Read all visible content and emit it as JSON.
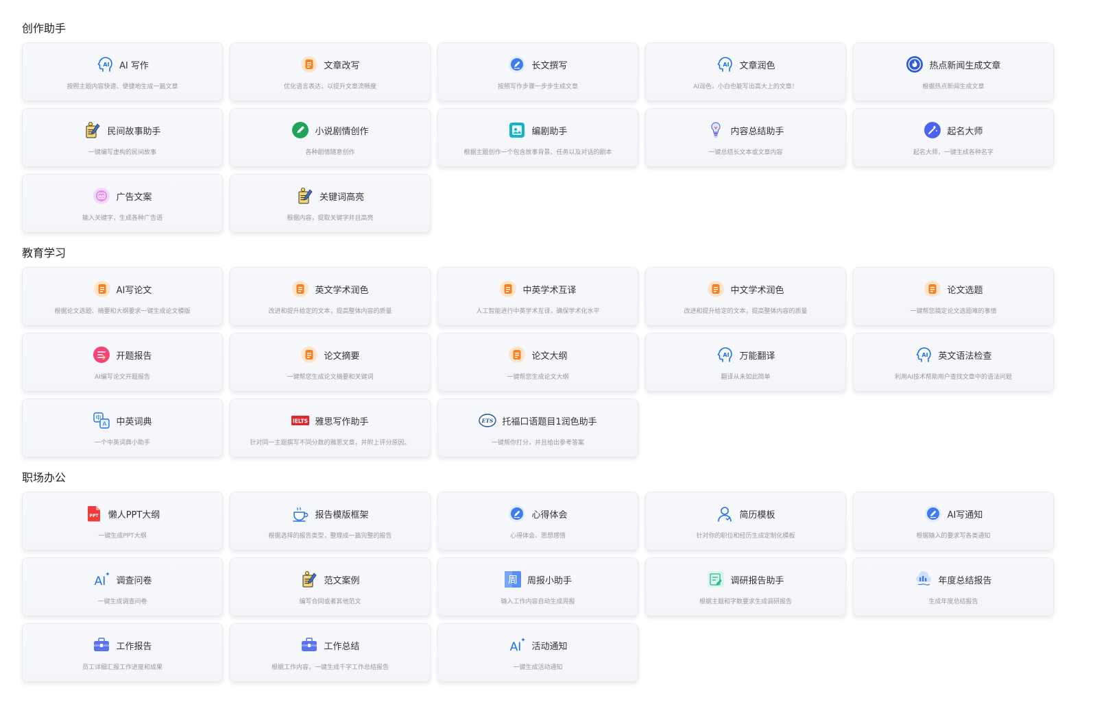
{
  "sections": [
    {
      "title": "创作助手",
      "cards": [
        {
          "title": "AI 写作",
          "desc": "按照主题内容快速、便捷地生成一篇文章",
          "icon": "ai-head-icon"
        },
        {
          "title": "文章改写",
          "desc": "优化语言表达，以提升文章流畅度",
          "icon": "doc-orange-icon"
        },
        {
          "title": "长文撰写",
          "desc": "按照写作步骤一步步生成文章",
          "icon": "pen-blue-icon"
        },
        {
          "title": "文章润色",
          "desc": "AI润色，小白也能写出高大上的文章！",
          "icon": "ai-head-icon"
        },
        {
          "title": "热点新闻生成文章",
          "desc": "根据热点新闻生成文章",
          "icon": "hot-news-icon"
        },
        {
          "title": "民间故事助手",
          "desc": "一键编写虚构的民间故事",
          "icon": "notepad-bulb-icon"
        },
        {
          "title": "小说剧情创作",
          "desc": "各种剧情随意创作",
          "icon": "pen-green-icon"
        },
        {
          "title": "编剧助手",
          "desc": "根据主题创作一个包含故事背景、任务以及对话的剧本",
          "icon": "script-teal-icon"
        },
        {
          "title": "内容总结助手",
          "desc": "一键总结长文本或文章内容",
          "icon": "lightbulb-icon"
        },
        {
          "title": "起名大师",
          "desc": "起名大师，一键生成各种名字",
          "icon": "magic-wand-icon"
        },
        {
          "title": "广告文案",
          "desc": "输入关键字，生成各种广告语",
          "icon": "ad-purple-icon"
        },
        {
          "title": "关键词高亮",
          "desc": "根据内容，提取关键字并且高亮",
          "icon": "notepad-bulb-icon"
        }
      ]
    },
    {
      "title": "教育学习",
      "cards": [
        {
          "title": "AI写论文",
          "desc": "根据论文选题、摘要和大纲要求一键生成论文模版",
          "icon": "doc-orange-icon"
        },
        {
          "title": "英文学术润色",
          "desc": "改进和提升给定的文本，提高整体内容的质量",
          "icon": "doc-orange-icon"
        },
        {
          "title": "中英学术互译",
          "desc": "人工智能进行中英学术互译，确保学术化水平",
          "icon": "doc-orange-icon"
        },
        {
          "title": "中文学术润色",
          "desc": "改进和提升给定的文本，提高整体内容的质量",
          "icon": "doc-orange-icon"
        },
        {
          "title": "论文选题",
          "desc": "一键帮您搞定论文选题难的事情",
          "icon": "doc-orange-icon"
        },
        {
          "title": "开题报告",
          "desc": "AI编写论文开题报告",
          "icon": "report-pink-icon"
        },
        {
          "title": "论文摘要",
          "desc": "一键帮您生成论文摘要和关键词",
          "icon": "doc-orange-icon"
        },
        {
          "title": "论文大纲",
          "desc": "一键帮您生成论文大纲",
          "icon": "doc-orange-icon"
        },
        {
          "title": "万能翻译",
          "desc": "翻译从未如此简单",
          "icon": "ai-head-icon"
        },
        {
          "title": "英文语法检查",
          "desc": "利用AI技术帮助用户查找文章中的语法问题",
          "icon": "ai-head-icon"
        },
        {
          "title": "中英词典",
          "desc": "一个中英词典小助手",
          "icon": "dictionary-icon"
        },
        {
          "title": "雅思写作助手",
          "desc": "针对同一主题撰写不同分数的雅思文章，并附上评分原因。",
          "icon": "ielts-icon"
        },
        {
          "title": "托福口语题目1润色助手",
          "desc": "一键帮你打分，并且给出参考答案",
          "icon": "ets-icon"
        }
      ]
    },
    {
      "title": "职场办公",
      "cards": [
        {
          "title": "懒人PPT大纲",
          "desc": "一键生成PPT大纲",
          "icon": "ppt-icon"
        },
        {
          "title": "报告模版框架",
          "desc": "根据选择的报告类型，整理成一篇完整的报告",
          "icon": "cup-icon"
        },
        {
          "title": "心得体会",
          "desc": "心得体会、思想感悟",
          "icon": "pen-blue-icon"
        },
        {
          "title": "简历模板",
          "desc": "针对你的职位和经历生成定制化模板",
          "icon": "user-outline-icon"
        },
        {
          "title": "AI写通知",
          "desc": "根据输入的要求写各类通知",
          "icon": "pen-blue-icon"
        },
        {
          "title": "调查问卷",
          "desc": "一键生成调查问卷",
          "icon": "ai-sparkle-icon"
        },
        {
          "title": "范文案例",
          "desc": "编写合同或者其他范文",
          "icon": "notepad-bulb-icon"
        },
        {
          "title": "周报小助手",
          "desc": "输入工作内容自动生成周报",
          "icon": "week-icon"
        },
        {
          "title": "调研报告助手",
          "desc": "根据主题和字数要求生成调研报告",
          "icon": "survey-icon"
        },
        {
          "title": "年度总结报告",
          "desc": "生成年度总结报告",
          "icon": "year-summary-icon"
        },
        {
          "title": "工作报告",
          "desc": "员工详细汇报工作进度和成果",
          "icon": "briefcase-icon"
        },
        {
          "title": "工作总结",
          "desc": "根据工作内容，一键生成千字工作总结报告",
          "icon": "briefcase-icon"
        },
        {
          "title": "活动通知",
          "desc": "一键生成活动通知",
          "icon": "ai-sparkle-icon"
        }
      ]
    }
  ],
  "icon_glyphs": {
    "ielts": "IELTS",
    "ets": "ETS",
    "ppt": "PPT",
    "week": "周",
    "ad": "AD",
    "ai": "AI",
    "dict_zh": "中",
    "dict_a": "A"
  },
  "colors": {
    "ai_blue": "#1a73e8",
    "doc_orange": "#f5821f",
    "pen_blue": "#3d7bf0",
    "green": "#1fa55b",
    "ielts_red": "#e0262b",
    "ppt_red": "#f03c3c"
  }
}
